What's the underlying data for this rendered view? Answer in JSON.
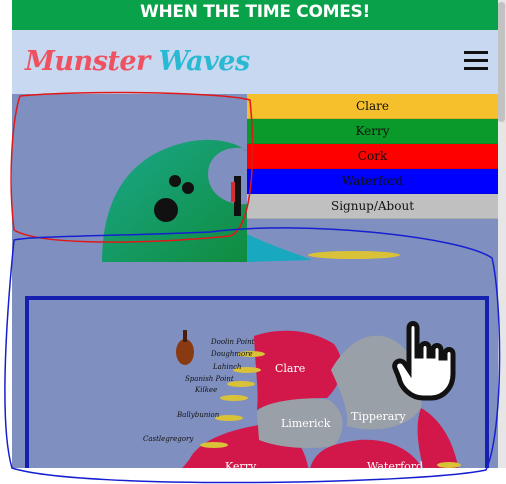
{
  "promo": {
    "text": "WHEN THE TIME COMES!"
  },
  "brand": {
    "word1": "Munster",
    "word2": "Waves"
  },
  "nav": {
    "items": [
      {
        "label": "Clare",
        "color": "#f5c02c"
      },
      {
        "label": "Kerry",
        "color": "#0a9a2a"
      },
      {
        "label": "Cork",
        "color": "#ff0000"
      },
      {
        "label": "Waterford",
        "color": "#0000ff"
      },
      {
        "label": "Signup/About",
        "color": "#c0c0c0"
      }
    ]
  },
  "map": {
    "counties": [
      "Clare",
      "Limerick",
      "Tipperary",
      "Kerry",
      "Waterford"
    ],
    "towns": [
      "Doolin Point",
      "Doughmore",
      "Lahinch",
      "Spanish Point",
      "Kilkee",
      "Ballybunion",
      "Castlegregory"
    ]
  },
  "colors": {
    "promo_bg": "#0aa14b",
    "navbar_bg": "#c8d8f0",
    "page_bg": "#7f8fbf",
    "county_red": "#d2174a",
    "county_grey": "#9aa0a8",
    "frame_blue": "#1620b0"
  },
  "icons": [
    "hamburger-menu-icon",
    "wave-logo-icon",
    "surfer-icon",
    "surfboard-icon",
    "violin-icon",
    "pointing-hand-icon"
  ]
}
